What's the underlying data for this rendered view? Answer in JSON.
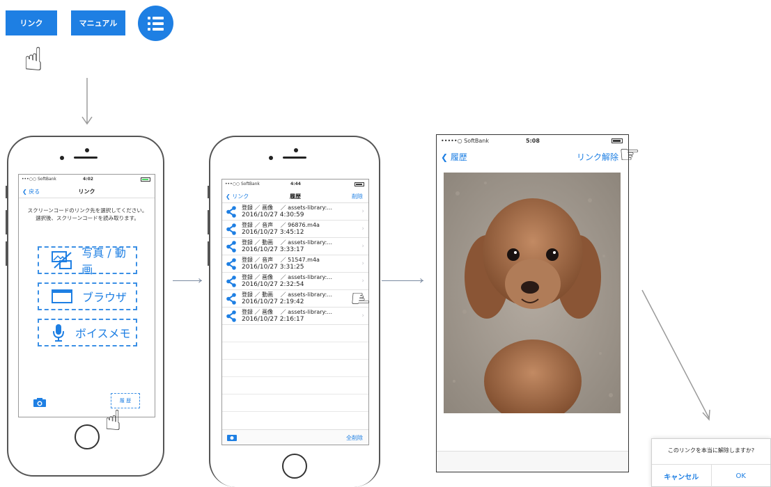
{
  "top_bar": {
    "link_label": "リンク",
    "manual_label": "マニュアル",
    "menu_icon": "list-icon"
  },
  "phone1": {
    "status": {
      "carrier": "•••○○ SoftBank",
      "time": "4:02"
    },
    "nav": {
      "back": "戻る",
      "title": "リンク"
    },
    "instructions": "スクリーンコードのリンク先を選択してください。選択後、スクリーンコードを読み取ります。",
    "options": [
      {
        "label": "写真 / 動画",
        "icon": "photo-video-icon"
      },
      {
        "label": "ブラウザ",
        "icon": "browser-icon"
      },
      {
        "label": "ボイスメモ",
        "icon": "microphone-icon"
      }
    ],
    "history_button": "履 歴",
    "camera_icon": "camera-icon"
  },
  "phone2": {
    "status": {
      "carrier": "•••○○ SoftBank",
      "time": "4:44"
    },
    "nav": {
      "back": "リンク",
      "title": "履歴",
      "right": "削除"
    },
    "rows": [
      {
        "line1": "登録 ／ 画像　 ／ assets-library:...",
        "line2": "2016/10/27 4:30:59"
      },
      {
        "line1": "登録 ／ 音声　 ／ 96876.m4a",
        "line2": "2016/10/27 3:45:12"
      },
      {
        "line1": "登録 ／ 動画　 ／ assets-library:...",
        "line2": "2016/10/27 3:33:17"
      },
      {
        "line1": "登録 ／ 音声　 ／ 51547.m4a",
        "line2": "2016/10/27 3:31:25"
      },
      {
        "line1": "登録 ／ 画像　 ／ assets-library:...",
        "line2": "2016/10/27 2:32:54"
      },
      {
        "line1": "登録 ／ 動画　 ／ assets-library:...",
        "line2": "2016/10/27 2:19:42"
      },
      {
        "line1": "登録 ／ 画像　 ／ assets-library:...",
        "line2": "2016/10/27 2:16:17"
      }
    ],
    "delete_all": "全削除",
    "camera_icon": "camera-icon"
  },
  "phone3": {
    "status": {
      "carrier": "•••••○ SoftBank",
      "time": "5:08"
    },
    "nav": {
      "back": "履歴",
      "right": "リンク解除"
    },
    "photo": "dog-photo"
  },
  "dialog": {
    "message": "このリンクを本当に解除しますか?",
    "cancel": "キャンセル",
    "ok": "OK"
  },
  "colors": {
    "accent": "#1e7fe3",
    "arrow": "#7a8aa0"
  }
}
